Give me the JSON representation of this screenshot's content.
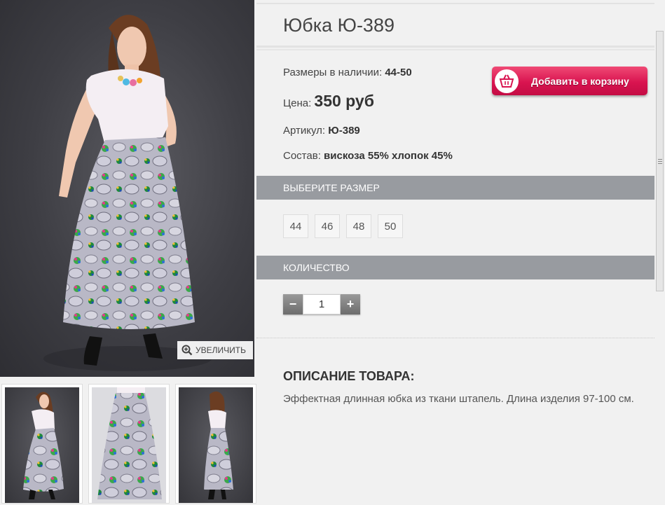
{
  "gallery": {
    "zoom_label": "УВЕЛИЧИТЬ"
  },
  "product": {
    "title": "Юбка Ю-389",
    "sizes_label": "Размеры в наличии:",
    "sizes_value": "44-50",
    "price_label": "Цена:",
    "price_value": "350 руб",
    "article_label": "Артикул:",
    "article_value": "Ю-389",
    "composition_label": "Состав:",
    "composition_value": "вискоза 55% хлопок 45%"
  },
  "cart_button": {
    "label": "Добавить в корзину",
    "color": "#d91450"
  },
  "size_section": {
    "title": "ВЫБЕРИТЕ РАЗМЕР",
    "sizes": [
      "44",
      "46",
      "48",
      "50"
    ]
  },
  "quantity_section": {
    "title": "КОЛИЧЕСТВО",
    "minus": "−",
    "plus": "+",
    "value": "1"
  },
  "description": {
    "title": "ОПИСАНИЕ ТОВАРА:",
    "text": "Эффектная длинная юбка из ткани штапель. Длина изделия 97-100 см."
  },
  "colors": {
    "section_bar": "#989ba0",
    "accent": "#d91450"
  }
}
